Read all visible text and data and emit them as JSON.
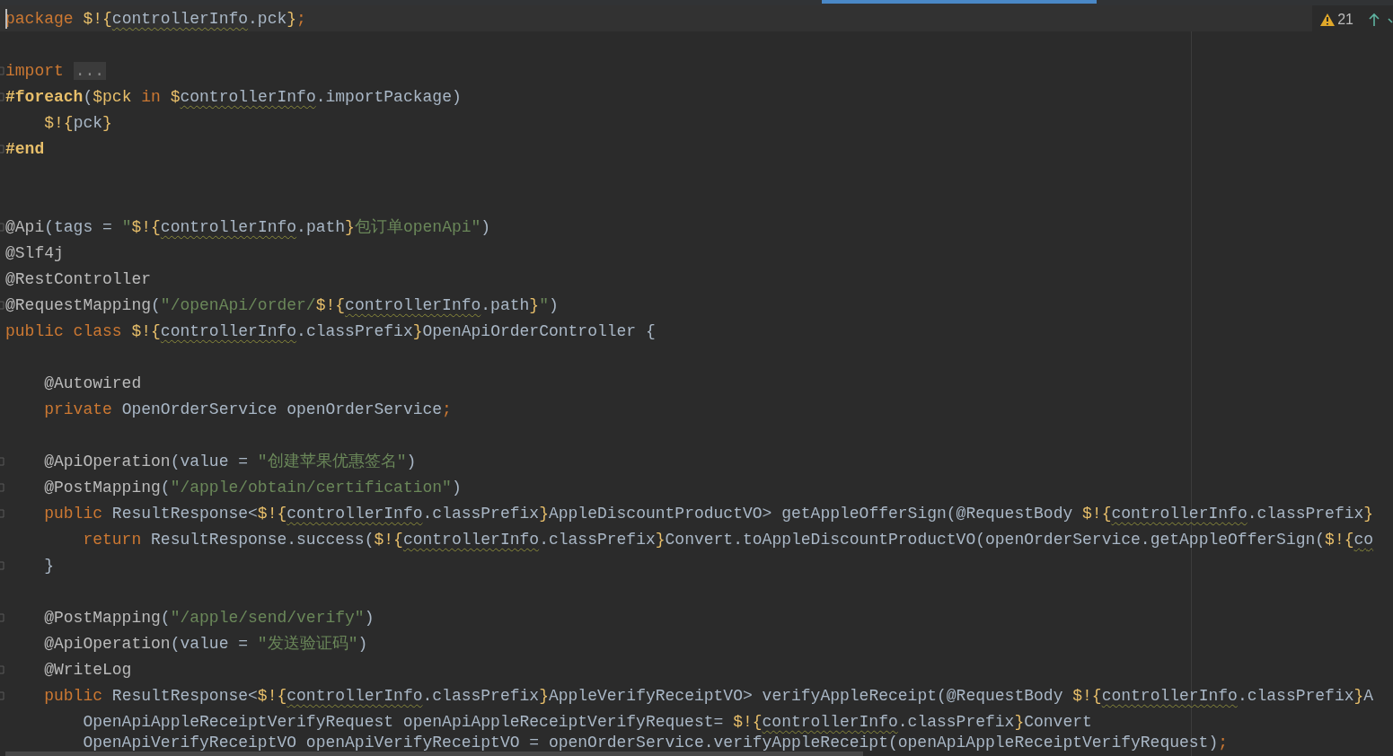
{
  "editor": {
    "inspection": {
      "warnings": "21"
    },
    "lines": [
      {
        "kind": "code",
        "current": true,
        "fold_marker": false,
        "tokens": [
          {
            "kind": "keyword",
            "text": "package "
          },
          {
            "kind": "template",
            "text": "$!{"
          },
          {
            "kind": "unresolved",
            "text": "controllerInfo"
          },
          {
            "kind": "plain",
            "text": ".pck"
          },
          {
            "kind": "template",
            "text": "}"
          },
          {
            "kind": "keyword",
            "text": ";"
          }
        ]
      },
      {
        "kind": "blank"
      },
      {
        "kind": "code",
        "current": false,
        "fold_marker": true,
        "tokens": [
          {
            "kind": "keyword",
            "text": "import "
          },
          {
            "kind": "folded",
            "text": "..."
          }
        ]
      },
      {
        "kind": "code",
        "current": false,
        "fold_marker": true,
        "tokens": [
          {
            "kind": "directive",
            "text": "#foreach"
          },
          {
            "kind": "plain",
            "text": "("
          },
          {
            "kind": "template",
            "text": "$pck "
          },
          {
            "kind": "keyword",
            "text": "in "
          },
          {
            "kind": "template",
            "text": "$"
          },
          {
            "kind": "unresolved",
            "text": "controllerInfo"
          },
          {
            "kind": "plain",
            "text": ".importPackage)"
          }
        ]
      },
      {
        "kind": "code",
        "current": false,
        "fold_marker": false,
        "tokens": [
          {
            "kind": "template",
            "text": "    $!{"
          },
          {
            "kind": "plain",
            "text": "pck"
          },
          {
            "kind": "template",
            "text": "}"
          }
        ]
      },
      {
        "kind": "code",
        "current": false,
        "fold_marker": true,
        "tokens": [
          {
            "kind": "directive",
            "text": "#end"
          }
        ]
      },
      {
        "kind": "blank"
      },
      {
        "kind": "blank"
      },
      {
        "kind": "code",
        "current": false,
        "fold_marker": true,
        "tokens": [
          {
            "kind": "annotation",
            "text": "@Api"
          },
          {
            "kind": "plain",
            "text": "(tags = "
          },
          {
            "kind": "string",
            "text": "\""
          },
          {
            "kind": "template",
            "text": "$!{"
          },
          {
            "kind": "unresolved",
            "text": "controllerInfo"
          },
          {
            "kind": "plain",
            "text": ".path"
          },
          {
            "kind": "template",
            "text": "}"
          },
          {
            "kind": "string",
            "text": "包订单openApi\""
          },
          {
            "kind": "plain",
            "text": ")"
          }
        ]
      },
      {
        "kind": "code",
        "current": false,
        "fold_marker": false,
        "tokens": [
          {
            "kind": "annotation",
            "text": "@Slf4j"
          }
        ]
      },
      {
        "kind": "code",
        "current": false,
        "fold_marker": false,
        "tokens": [
          {
            "kind": "annotation",
            "text": "@RestController"
          }
        ]
      },
      {
        "kind": "code",
        "current": false,
        "fold_marker": true,
        "tokens": [
          {
            "kind": "annotation",
            "text": "@RequestMapping"
          },
          {
            "kind": "plain",
            "text": "("
          },
          {
            "kind": "string",
            "text": "\"/openApi/order/"
          },
          {
            "kind": "template",
            "text": "$!{"
          },
          {
            "kind": "unresolved",
            "text": "controllerInfo"
          },
          {
            "kind": "plain",
            "text": ".path"
          },
          {
            "kind": "template",
            "text": "}"
          },
          {
            "kind": "string",
            "text": "\""
          },
          {
            "kind": "plain",
            "text": ")"
          }
        ]
      },
      {
        "kind": "code",
        "current": false,
        "fold_marker": false,
        "tokens": [
          {
            "kind": "keyword",
            "text": "public class "
          },
          {
            "kind": "template",
            "text": "$!{"
          },
          {
            "kind": "unresolved",
            "text": "controllerInfo"
          },
          {
            "kind": "plain",
            "text": ".classPrefix"
          },
          {
            "kind": "template",
            "text": "}"
          },
          {
            "kind": "plain",
            "text": "OpenApiOrderController {"
          }
        ]
      },
      {
        "kind": "blank"
      },
      {
        "kind": "code",
        "current": false,
        "fold_marker": false,
        "tokens": [
          {
            "kind": "annotation",
            "text": "    @Autowired"
          }
        ]
      },
      {
        "kind": "code",
        "current": false,
        "fold_marker": false,
        "tokens": [
          {
            "kind": "keyword",
            "text": "    private "
          },
          {
            "kind": "plain",
            "text": "OpenOrderService openOrderService"
          },
          {
            "kind": "keyword",
            "text": ";"
          }
        ]
      },
      {
        "kind": "blank"
      },
      {
        "kind": "code",
        "current": false,
        "fold_marker": true,
        "tokens": [
          {
            "kind": "annotation",
            "text": "    @ApiOperation"
          },
          {
            "kind": "plain",
            "text": "(value = "
          },
          {
            "kind": "string",
            "text": "\"创建苹果优惠签名\""
          },
          {
            "kind": "plain",
            "text": ")"
          }
        ]
      },
      {
        "kind": "code",
        "current": false,
        "fold_marker": true,
        "tokens": [
          {
            "kind": "annotation",
            "text": "    @PostMapping"
          },
          {
            "kind": "plain",
            "text": "("
          },
          {
            "kind": "string",
            "text": "\"/apple/obtain/certification\""
          },
          {
            "kind": "plain",
            "text": ")"
          }
        ]
      },
      {
        "kind": "code",
        "current": false,
        "fold_marker": true,
        "tokens": [
          {
            "kind": "keyword",
            "text": "    public "
          },
          {
            "kind": "plain",
            "text": "ResultResponse<"
          },
          {
            "kind": "template",
            "text": "$!{"
          },
          {
            "kind": "unresolved",
            "text": "controllerInfo"
          },
          {
            "kind": "plain",
            "text": ".classPrefix"
          },
          {
            "kind": "template",
            "text": "}"
          },
          {
            "kind": "plain",
            "text": "AppleDiscountProductVO> getAppleOfferSign(@RequestBody "
          },
          {
            "kind": "template",
            "text": "$!{"
          },
          {
            "kind": "unresolved",
            "text": "controllerInfo"
          },
          {
            "kind": "plain",
            "text": ".classPrefix"
          },
          {
            "kind": "template",
            "text": "}"
          }
        ]
      },
      {
        "kind": "code",
        "current": false,
        "fold_marker": false,
        "tokens": [
          {
            "kind": "keyword",
            "text": "        return "
          },
          {
            "kind": "plain",
            "text": "ResultResponse.success("
          },
          {
            "kind": "template",
            "text": "$!{"
          },
          {
            "kind": "unresolved",
            "text": "controllerInfo"
          },
          {
            "kind": "plain",
            "text": ".classPrefix"
          },
          {
            "kind": "template",
            "text": "}"
          },
          {
            "kind": "plain",
            "text": "Convert.toAppleDiscountProductVO(openOrderService.getAppleOfferSign("
          },
          {
            "kind": "template",
            "text": "$!{"
          },
          {
            "kind": "unresolved",
            "text": "co"
          }
        ]
      },
      {
        "kind": "code",
        "current": false,
        "fold_marker": true,
        "tokens": [
          {
            "kind": "plain",
            "text": "    }"
          }
        ]
      },
      {
        "kind": "blank"
      },
      {
        "kind": "code",
        "current": false,
        "fold_marker": true,
        "tokens": [
          {
            "kind": "annotation",
            "text": "    @PostMapping"
          },
          {
            "kind": "plain",
            "text": "("
          },
          {
            "kind": "string",
            "text": "\"/apple/send/verify\""
          },
          {
            "kind": "plain",
            "text": ")"
          }
        ]
      },
      {
        "kind": "code",
        "current": false,
        "fold_marker": false,
        "tokens": [
          {
            "kind": "annotation",
            "text": "    @ApiOperation"
          },
          {
            "kind": "plain",
            "text": "(value = "
          },
          {
            "kind": "string",
            "text": "\"发送验证码\""
          },
          {
            "kind": "plain",
            "text": ")"
          }
        ]
      },
      {
        "kind": "code",
        "current": false,
        "fold_marker": true,
        "tokens": [
          {
            "kind": "annotation",
            "text": "    @WriteLog"
          }
        ]
      },
      {
        "kind": "code",
        "current": false,
        "fold_marker": true,
        "tokens": [
          {
            "kind": "keyword",
            "text": "    public "
          },
          {
            "kind": "plain",
            "text": "ResultResponse<"
          },
          {
            "kind": "template",
            "text": "$!{"
          },
          {
            "kind": "unresolved",
            "text": "controllerInfo"
          },
          {
            "kind": "plain",
            "text": ".classPrefix"
          },
          {
            "kind": "template",
            "text": "}"
          },
          {
            "kind": "plain",
            "text": "AppleVerifyReceiptVO> verifyAppleReceipt(@RequestBody "
          },
          {
            "kind": "template",
            "text": "$!{"
          },
          {
            "kind": "unresolved",
            "text": "controllerInfo"
          },
          {
            "kind": "plain",
            "text": ".classPrefix"
          },
          {
            "kind": "template",
            "text": "}"
          },
          {
            "kind": "plain",
            "text": "A"
          }
        ]
      },
      {
        "kind": "code",
        "current": false,
        "fold_marker": false,
        "tokens": [
          {
            "kind": "plain",
            "text": "        OpenApiAppleReceiptVerifyRequest openApiAppleReceiptVerifyRequest= "
          },
          {
            "kind": "template",
            "text": "$!{"
          },
          {
            "kind": "unresolved",
            "text": "controllerInfo"
          },
          {
            "kind": "plain",
            "text": ".classPrefix"
          },
          {
            "kind": "template",
            "text": "}"
          },
          {
            "kind": "plain",
            "text": "Convert"
          }
        ]
      },
      {
        "kind": "code",
        "current": false,
        "fold_marker": false,
        "tokens": [
          {
            "kind": "plain",
            "text": "        OpenApiVerifyReceiptVO openApiVerifyReceiptVO = openOrderService.verifyAppleReceipt(openApiAppleReceiptVerifyRequest)"
          },
          {
            "kind": "keyword",
            "text": ";"
          }
        ]
      }
    ]
  }
}
